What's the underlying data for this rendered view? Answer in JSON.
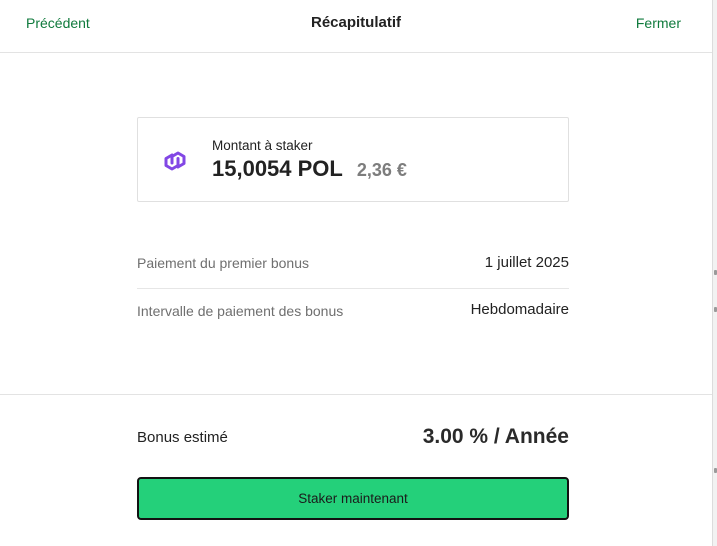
{
  "header": {
    "back_label": "Précédent",
    "title": "Récapitulatif",
    "close_label": "Fermer"
  },
  "amount": {
    "label": "Montant à staker",
    "value": "15,0054 POL",
    "fiat": "2,36 €",
    "token_icon": "polygon-icon",
    "token_color": "#8247e5"
  },
  "details": [
    {
      "label": "Paiement du premier bonus",
      "value": "1 juillet 2025"
    },
    {
      "label": "Intervalle de paiement des bonus",
      "value": "Hebdomadaire"
    }
  ],
  "estimate": {
    "label": "Bonus estimé",
    "value": "3.00 % / Année"
  },
  "actions": {
    "stake_label": "Staker maintenant"
  },
  "colors": {
    "accent_link": "#0f7a3c",
    "button_bg": "#24d07a"
  }
}
